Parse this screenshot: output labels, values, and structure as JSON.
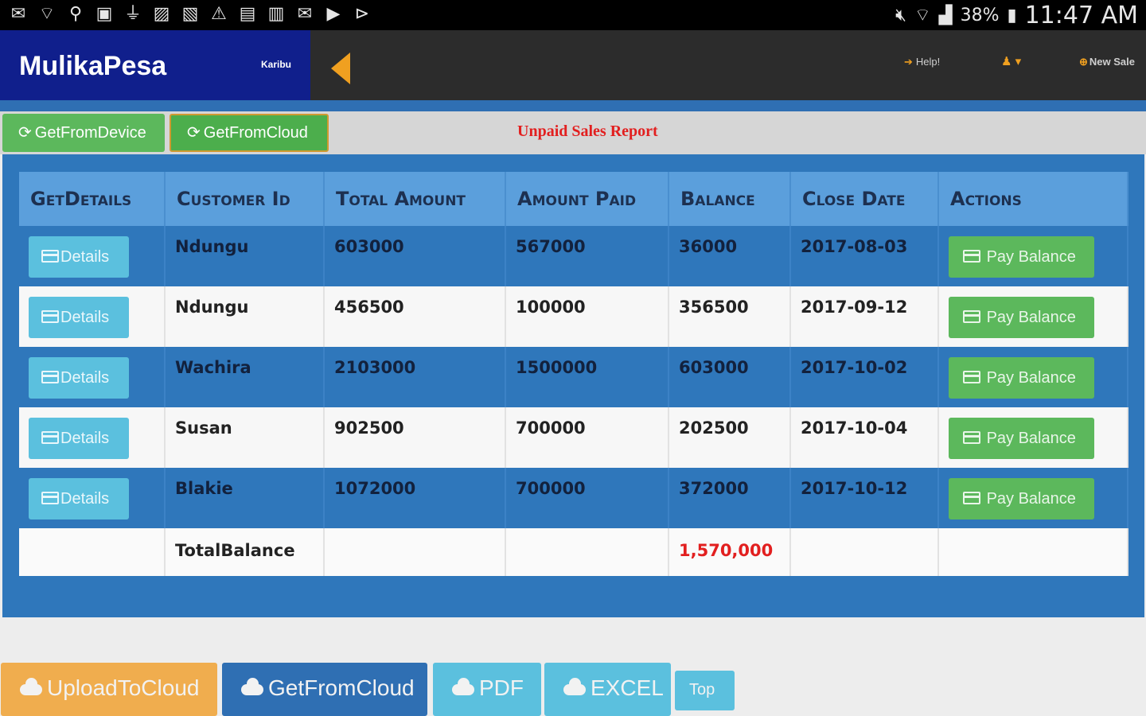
{
  "status_bar": {
    "battery": "38%",
    "clock": "11:47 AM",
    "left_icons": [
      "mail-icon",
      "wifi-icon",
      "keyhole-icon",
      "youtube-icon",
      "usb-icon",
      "image-icon",
      "gallery-icon",
      "warning-icon",
      "message-icon",
      "chat-icon",
      "gmail-icon",
      "play-icon",
      "play-store-icon"
    ],
    "right_icons": [
      "mute-icon",
      "wifi-signal-icon",
      "cell-signal-icon",
      "battery-icon"
    ]
  },
  "header": {
    "brand": "MulikaPesa",
    "greeting": "Karibu",
    "help": "Help!",
    "new_sale": "New Sale",
    "colors": {
      "brand_bg": "#101f8c",
      "nav_bg": "#2c2c2c",
      "accent": "#f0a020"
    }
  },
  "toolbar": {
    "get_from_device": "GetFromDevice",
    "get_from_cloud": "GetFromCloud",
    "report_title": "Unpaid Sales Report"
  },
  "table": {
    "columns": [
      "GetDetails",
      "Customer Id",
      "Total Amount",
      "Amount Paid",
      "Balance",
      "Close Date",
      "Actions"
    ],
    "details_label": "Details",
    "pay_label": "Pay Balance",
    "rows": [
      {
        "customer": "Ndungu",
        "total": "603000",
        "paid": "567000",
        "balance": "36000",
        "close_date": "2017-08-03"
      },
      {
        "customer": "Ndungu",
        "total": "456500",
        "paid": "100000",
        "balance": "356500",
        "close_date": "2017-09-12"
      },
      {
        "customer": "Wachira",
        "total": "2103000",
        "paid": "1500000",
        "balance": "603000",
        "close_date": "2017-10-02"
      },
      {
        "customer": "Susan",
        "total": "902500",
        "paid": "700000",
        "balance": "202500",
        "close_date": "2017-10-04"
      },
      {
        "customer": "Blakie",
        "total": "1072000",
        "paid": "700000",
        "balance": "372000",
        "close_date": "2017-10-12"
      }
    ],
    "total_label": "TotalBalance",
    "total_value": "1,570,000"
  },
  "bottom": {
    "upload": "UploadToCloud",
    "get_from_cloud": "GetFromCloud",
    "pdf": "PDF",
    "excel": "EXCEL",
    "top": "Top"
  }
}
